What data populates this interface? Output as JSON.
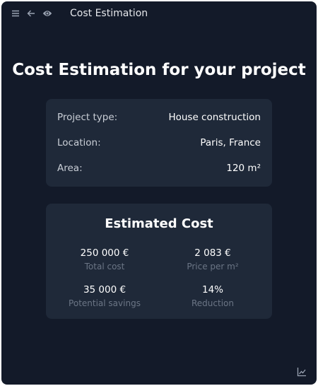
{
  "topbar": {
    "title": "Cost Estimation",
    "icons": [
      "menu-icon",
      "back-arrow-icon",
      "eye-icon"
    ]
  },
  "heading": "Cost Estimation for your project",
  "details": {
    "project_type": {
      "label": "Project type:",
      "value": "House construction"
    },
    "location": {
      "label": "Location:",
      "value": "Paris, France"
    },
    "area": {
      "label": "Area:",
      "value": "120 m²"
    }
  },
  "estimate": {
    "title": "Estimated Cost",
    "total_cost": {
      "value": "250 000 €",
      "caption": "Total cost"
    },
    "price_per_m2": {
      "value": "2 083 €",
      "caption": "Price per m²"
    },
    "savings": {
      "value": "35 000 €",
      "caption": "Potential savings"
    },
    "reduction": {
      "value": "14%",
      "caption": "Reduction"
    }
  },
  "footer": {
    "icon": "chart-icon"
  },
  "colors": {
    "background": "#131a29",
    "card": "#1f2939",
    "muted_text": "#6b7585"
  }
}
